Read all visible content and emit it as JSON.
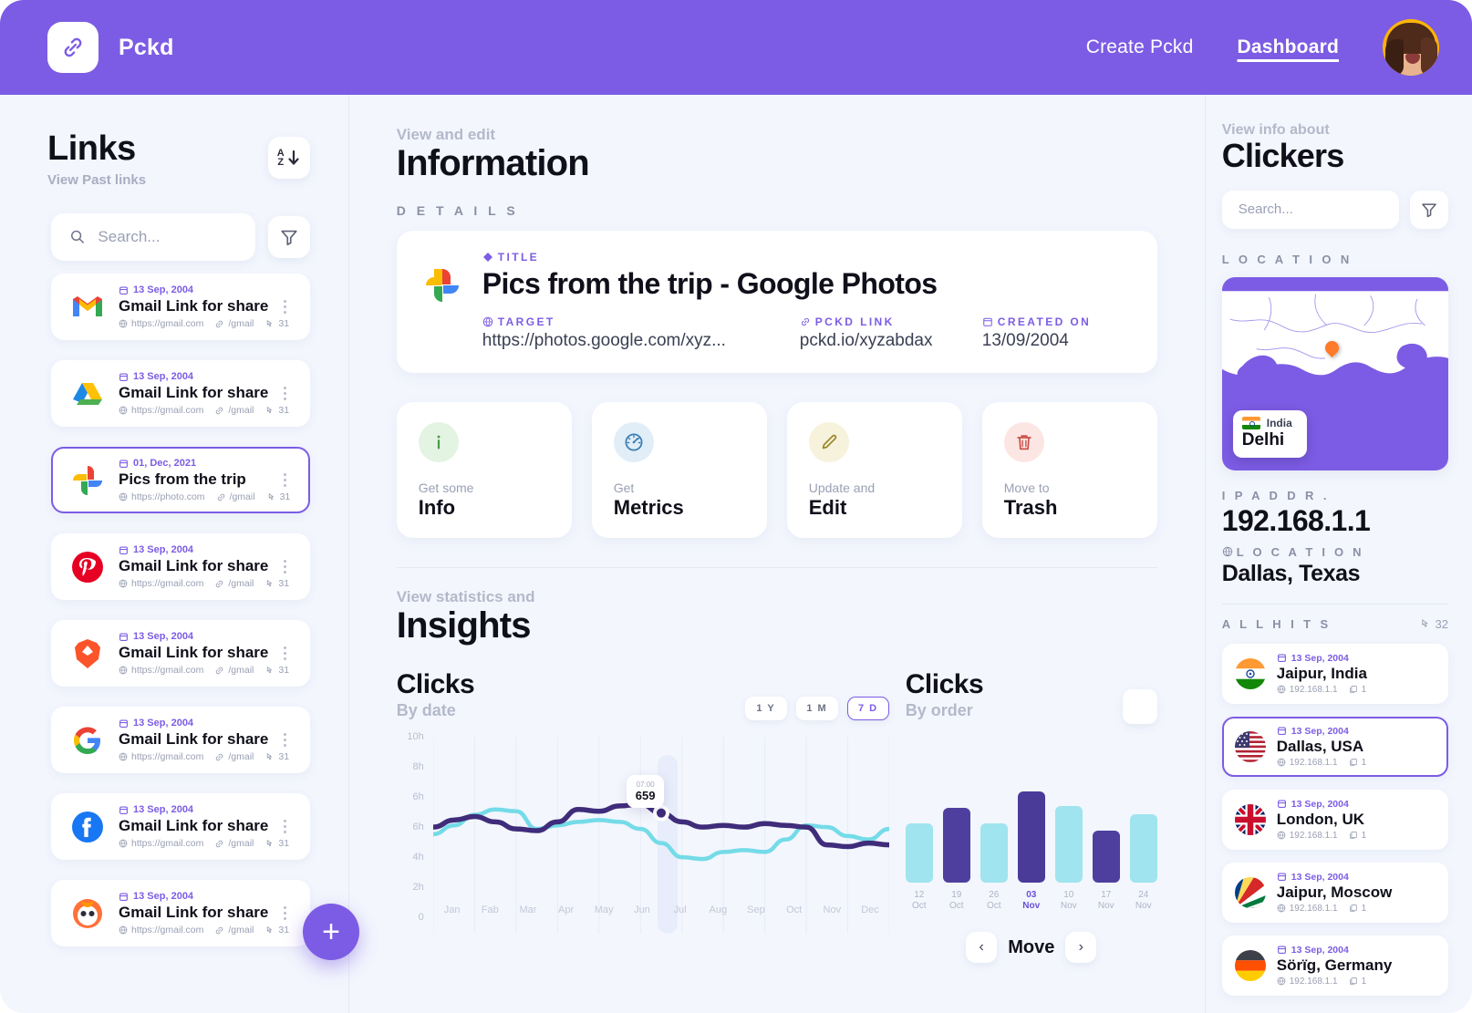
{
  "header": {
    "brand": "Pckd",
    "logo_icon": "link-icon",
    "nav": [
      {
        "label": "Create Pckd",
        "active": false
      },
      {
        "label": "Dashboard",
        "active": true
      }
    ],
    "avatar_alt": "user-avatar"
  },
  "links_panel": {
    "title": "Links",
    "subtitle": "View Past links",
    "sort_icon": "sort-az-icon",
    "sort_a": "A",
    "sort_z": "Z",
    "filter_icon": "filter-icon",
    "search_placeholder": "Search...",
    "search_value": "",
    "add_button": "+",
    "items": [
      {
        "date": "13 Sep, 2004",
        "title": "Gmail Link for share",
        "url": "https://gmail.com",
        "slug": "/gmail",
        "clicks": "31",
        "favicon": "gmail",
        "selected": false
      },
      {
        "date": "13 Sep, 2004",
        "title": "Gmail Link for share",
        "url": "https://gmail.com",
        "slug": "/gmail",
        "clicks": "31",
        "favicon": "gdrive",
        "selected": false
      },
      {
        "date": "01, Dec, 2021",
        "title": "Pics from the trip",
        "url": "https://photo.com",
        "slug": "/gmail",
        "clicks": "31",
        "favicon": "gphotos",
        "selected": true
      },
      {
        "date": "13 Sep, 2004",
        "title": "Gmail Link for share",
        "url": "https://gmail.com",
        "slug": "/gmail",
        "clicks": "31",
        "favicon": "pinterest",
        "selected": false
      },
      {
        "date": "13 Sep, 2004",
        "title": "Gmail Link for share",
        "url": "https://gmail.com",
        "slug": "/gmail",
        "clicks": "31",
        "favicon": "brave",
        "selected": false
      },
      {
        "date": "13 Sep, 2004",
        "title": "Gmail Link for share",
        "url": "https://gmail.com",
        "slug": "/gmail",
        "clicks": "31",
        "favicon": "google",
        "selected": false
      },
      {
        "date": "13 Sep, 2004",
        "title": "Gmail Link for share",
        "url": "https://gmail.com",
        "slug": "/gmail",
        "clicks": "31",
        "favicon": "facebook",
        "selected": false
      },
      {
        "date": "13 Sep, 2004",
        "title": "Gmail Link for share",
        "url": "https://gmail.com",
        "slug": "/gmail",
        "clicks": "31",
        "favicon": "firefox",
        "selected": false
      }
    ]
  },
  "information": {
    "eyebrow": "View and edit",
    "title": "Information",
    "section_label": "D E T A I L S",
    "details": {
      "title_label": "TITLE",
      "title_value": "Pics from the trip - Google Photos",
      "target_label": "TARGET",
      "target_value": "https://photos.google.com/xyz...",
      "pckd_label": "PCKD LINK",
      "pckd_value": "pckd.io/xyzabdax",
      "created_label": "CREATED ON",
      "created_value": "13/09/2004"
    },
    "actions": [
      {
        "sub": "Get some",
        "main": "Info",
        "icon": "info-icon",
        "bg": "#e4f4e2",
        "fg": "#4c9a45"
      },
      {
        "sub": "Get",
        "main": "Metrics",
        "icon": "speedometer-icon",
        "bg": "#e1eef8",
        "fg": "#3d7fb5"
      },
      {
        "sub": "Update and",
        "main": "Edit",
        "icon": "pencil-icon",
        "bg": "#f6f2dc",
        "fg": "#9a8a2c"
      },
      {
        "sub": "Move to",
        "main": "Trash",
        "icon": "trash-icon",
        "bg": "#fbe6e4",
        "fg": "#c9524a"
      }
    ]
  },
  "insights": {
    "eyebrow": "View statistics and",
    "title": "Insights"
  },
  "chart_data": [
    {
      "type": "line",
      "title": "Clicks",
      "subtitle": "By date",
      "xlabel": "",
      "ylabel": "",
      "ylim": [
        0,
        10
      ],
      "yticks": [
        "10h",
        "8h",
        "6h",
        "6h",
        "4h",
        "2h",
        "0"
      ],
      "categories": [
        "Jan",
        "Fab",
        "Mar",
        "Apr",
        "May",
        "Jun",
        "Jul",
        "Aug",
        "Sep",
        "Oct",
        "Nov",
        "Dec"
      ],
      "grid": true,
      "legend": "none",
      "range_tabs": [
        {
          "label": "1 Y",
          "active": false
        },
        {
          "label": "1 M",
          "active": false
        },
        {
          "label": "7 D",
          "active": true
        }
      ],
      "tooltip": {
        "time": "07:00",
        "value": "659"
      },
      "series": [
        {
          "name": "primary",
          "color": "#3f2c7a",
          "values": [
            5.3,
            5.7,
            5.9,
            5.6,
            5.2,
            5.1,
            5.6,
            6.3,
            6.2,
            6.5,
            6.6,
            6.1,
            5.6,
            5.3,
            5.4,
            5.3,
            5.5,
            5.4,
            5.3,
            4.3,
            4.2,
            4.4,
            4.3
          ]
        },
        {
          "name": "secondary",
          "color": "#74dbe8",
          "values": [
            4.9,
            5.4,
            6.0,
            6.3,
            6.2,
            5.2,
            5.4,
            5.6,
            5.7,
            5.6,
            5.2,
            4.4,
            3.6,
            3.5,
            3.9,
            4.0,
            3.9,
            4.6,
            5.4,
            5.3,
            4.8,
            4.6,
            5.2
          ]
        }
      ]
    },
    {
      "type": "bar",
      "title": "Clicks",
      "subtitle": "By order",
      "categories": [
        "12\nOct",
        "19\nOct",
        "26\nOct",
        "03\nNov",
        "10\nNov",
        "17\nNov",
        "24\nNov"
      ],
      "cat_day": [
        "12",
        "19",
        "26",
        "03",
        "10",
        "17",
        "24"
      ],
      "cat_month": [
        "Oct",
        "Oct",
        "Oct",
        "Nov",
        "Nov",
        "Nov",
        "Nov"
      ],
      "active_index": 3,
      "values": [
        62,
        78,
        62,
        96,
        80,
        55,
        72
      ],
      "colors": [
        "#9fe4ee",
        "#4e3f9e",
        "#9fe4ee",
        "#4a3b99",
        "#9fe4ee",
        "#4e3f9e",
        "#9fe4ee"
      ],
      "ylim": [
        0,
        100
      ],
      "grid": false,
      "legend": "none",
      "pagination": {
        "prev": "‹",
        "label": "Move",
        "next": "›"
      }
    }
  ],
  "clickers": {
    "eyebrow": "View info about",
    "title": "Clickers",
    "search_placeholder": "Search...",
    "search_value": "",
    "filter_icon": "filter-icon",
    "location_label": "L O C A T I O N",
    "map": {
      "country": "India",
      "city": "Delhi",
      "pin_icon": "map-pin-icon"
    },
    "ip_label": "I P   A D D R .",
    "ip_value": "192.168.1.1",
    "loc_label": "L O C A T I O N",
    "loc_value": "Dallas, Texas",
    "hits_label": "A L L   H I T S",
    "hits_count": "32",
    "hits": [
      {
        "date": "13 Sep, 2004",
        "city": "Jaipur, India",
        "ip": "192.168.1.1",
        "count": "1",
        "flag": "in",
        "selected": false
      },
      {
        "date": "13 Sep, 2004",
        "city": "Dallas, USA",
        "ip": "192.168.1.1",
        "count": "1",
        "flag": "us",
        "selected": true
      },
      {
        "date": "13 Sep, 2004",
        "city": "London, UK",
        "ip": "192.168.1.1",
        "count": "1",
        "flag": "uk",
        "selected": false
      },
      {
        "date": "13 Sep, 2004",
        "city": "Jaipur, Moscow",
        "ip": "192.168.1.1",
        "count": "1",
        "flag": "sc",
        "selected": false
      },
      {
        "date": "13 Sep, 2004",
        "city": "Sörïg, Germany",
        "ip": "192.168.1.1",
        "count": "1",
        "flag": "de",
        "selected": false
      }
    ]
  },
  "theme": {
    "brand": "#7c5ce4",
    "bg": "#f3f6fd",
    "ink": "#10101b",
    "muted": "#9aa0b4"
  }
}
